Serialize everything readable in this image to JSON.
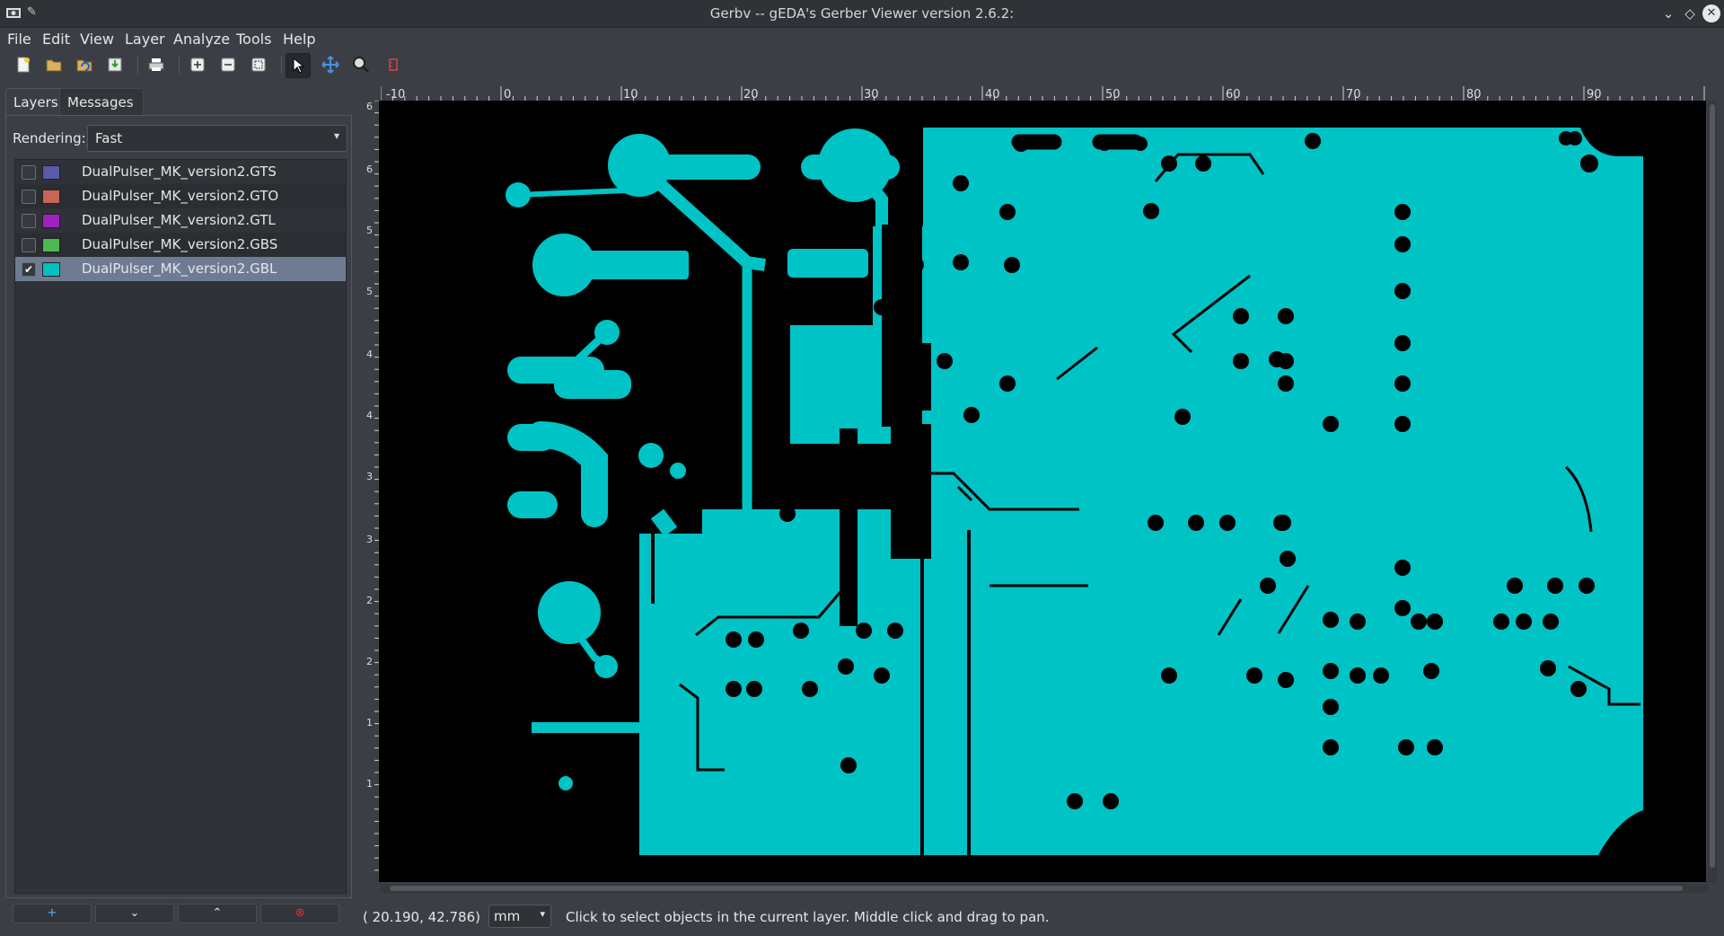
{
  "window": {
    "title": "Gerbv -- gEDA's Gerber Viewer version 2.6.2:",
    "controls": [
      "minimize",
      "maximize",
      "close"
    ]
  },
  "menu": [
    "File",
    "Edit",
    "View",
    "Layer",
    "Analyze",
    "Tools",
    "Help"
  ],
  "toolbar": {
    "buttons": [
      "new-project",
      "open-project",
      "revert",
      "save",
      "print",
      "zoom-in",
      "zoom-out",
      "zoom-fit",
      "pointer-tool",
      "pan-tool",
      "zoom-tool",
      "measure-tool"
    ],
    "active": "pointer-tool"
  },
  "tabs": {
    "layers": "Layers",
    "messages": "Messages",
    "selected": "Layers"
  },
  "rendering": {
    "label": "Rendering:",
    "value": "Fast"
  },
  "layers": [
    {
      "name": "DualPulser_MK_version2.GTS",
      "color": "#5a5aa8",
      "visible": false
    },
    {
      "name": "DualPulser_MK_version2.GTO",
      "color": "#c8645a",
      "visible": false
    },
    {
      "name": "DualPulser_MK_version2.GTL",
      "color": "#a020c0",
      "visible": false
    },
    {
      "name": "DualPulser_MK_version2.GBS",
      "color": "#50b850",
      "visible": false
    },
    {
      "name": "DualPulser_MK_version2.GBL",
      "color": "#00c0c0",
      "visible": true,
      "selected": true
    }
  ],
  "layer_buttons": [
    "add-layer",
    "move-down",
    "move-up",
    "remove-layer"
  ],
  "ruler": {
    "horizontal": [
      "-10",
      "0",
      "10",
      "20",
      "30",
      "40",
      "50",
      "60",
      "70",
      "80",
      "90"
    ],
    "vertical": [
      "6",
      "6",
      "5",
      "5",
      "4",
      "4",
      "3",
      "3",
      "2",
      "2",
      "1",
      "1"
    ]
  },
  "status": {
    "coords": "(  20.190,   42.786)",
    "unit": "mm",
    "message": "Click to select objects in the current layer. Middle click and drag to pan."
  },
  "colors": {
    "copper": "#00c3c6",
    "background": "#000000",
    "window": "#3b3f45"
  }
}
